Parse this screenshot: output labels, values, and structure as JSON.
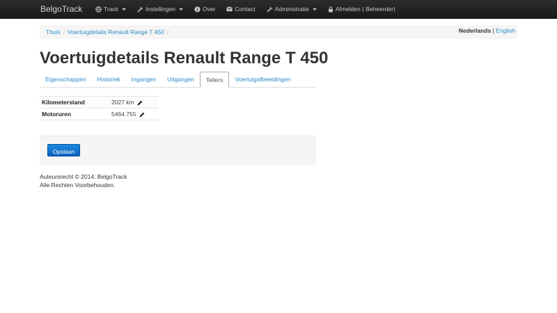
{
  "navbar": {
    "brand": "BelgoTrack",
    "items": [
      {
        "label": "Track",
        "icon": "globe-icon",
        "dropdown": true
      },
      {
        "label": "Instellingen",
        "icon": "wrench-icon",
        "dropdown": true
      },
      {
        "label": "Over",
        "icon": "info-icon",
        "dropdown": false
      },
      {
        "label": "Contact",
        "icon": "envelope-icon",
        "dropdown": false
      },
      {
        "label": "Administratie",
        "icon": "wrench-icon",
        "dropdown": true
      },
      {
        "label": "Afmelden ( Beheerder)",
        "icon": "lock-icon",
        "dropdown": false
      }
    ]
  },
  "breadcrumb": {
    "items": [
      "Thuis",
      "Voertuigdetails Renault Range T 450"
    ],
    "separator": "/"
  },
  "language": {
    "active": "Nederlands",
    "divider": "|",
    "other": "English"
  },
  "page": {
    "title": "Voertuigdetails Renault Range T 450"
  },
  "tabs": [
    {
      "label": "Eigenschappen",
      "active": false
    },
    {
      "label": "Historiek",
      "active": false
    },
    {
      "label": "Ingangen",
      "active": false
    },
    {
      "label": "Uitgangen",
      "active": false
    },
    {
      "label": "Tellers",
      "active": true
    },
    {
      "label": "Voertuigafbeeldingen",
      "active": false
    }
  ],
  "counters": [
    {
      "label": "Kilometerstand",
      "value": "2027 km"
    },
    {
      "label": "Motoruren",
      "value": "5464.755"
    }
  ],
  "form": {
    "save_label": "Opslaan"
  },
  "footer": {
    "line1": "Auteursrecht © 2014: BelgoTrack",
    "line2": "Alle Rechten Voorbehouden."
  },
  "colors": {
    "navbar": "#1f1f1f",
    "link": "#2a8ac8",
    "primary_button": "#0f6fd0"
  }
}
